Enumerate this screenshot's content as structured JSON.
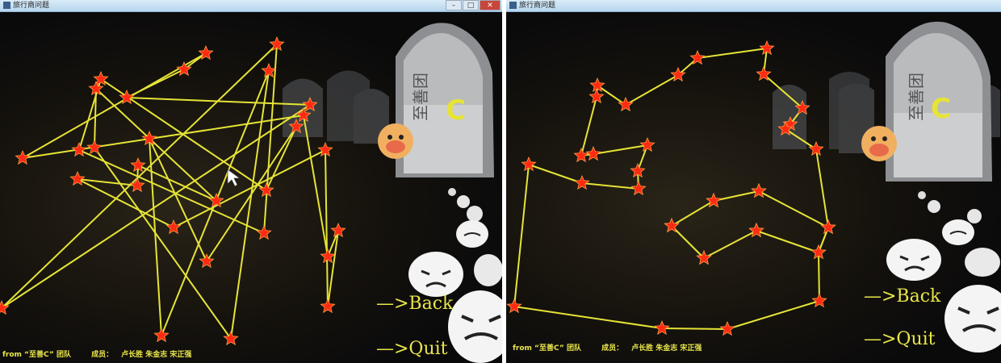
{
  "left_window": {
    "title": "旅行商问题",
    "window_buttons": [
      "–",
      "□",
      "✕"
    ],
    "logo_letter": "C",
    "back_label": "—>Back",
    "quit_label": "—>Quit",
    "footer_team": "from “至善C” 团队",
    "footer_members_label": "成员：",
    "footer_members": "卢长胜  朱金志  宋正强",
    "colors": {
      "route": "#e6e436",
      "city": "#ff2a12",
      "text": "#e8e64a"
    }
  },
  "right_window": {
    "title": "旅行商问题",
    "logo_letter": "C",
    "back_label": "—>Back",
    "quit_label": "—>Quit",
    "footer_team": "from “至善C” 团队",
    "footer_members_label": "成员：",
    "footer_members": "卢长胜  朱金志  宋正强"
  }
}
